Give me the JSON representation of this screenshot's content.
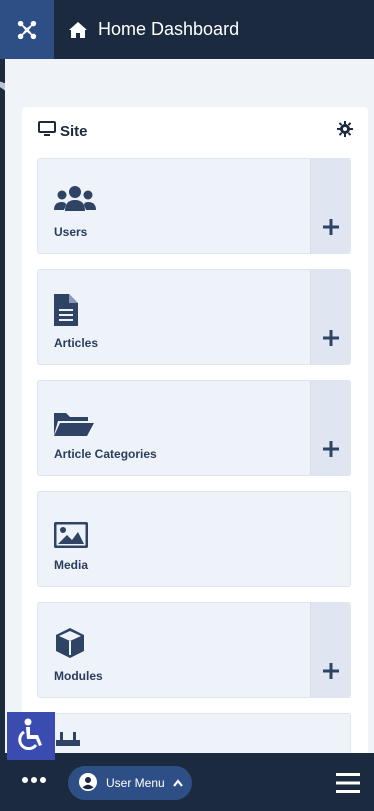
{
  "header": {
    "title": "Home Dashboard"
  },
  "site": {
    "title": "Site",
    "tiles": [
      {
        "label": "Users",
        "icon": "users-icon",
        "add": true
      },
      {
        "label": "Articles",
        "icon": "file-icon",
        "add": true
      },
      {
        "label": "Article Categories",
        "icon": "folder-open-icon",
        "add": true
      },
      {
        "label": "Media",
        "icon": "image-icon",
        "add": false
      },
      {
        "label": "Modules",
        "icon": "cube-icon",
        "add": true
      }
    ]
  },
  "bottom": {
    "user_menu": "User Menu"
  },
  "colors": {
    "navy": "#1c2a40",
    "brand_blue": "#2e4f86",
    "accessibility": "#3a4cb0",
    "tile_bg": "#eef2f9"
  }
}
